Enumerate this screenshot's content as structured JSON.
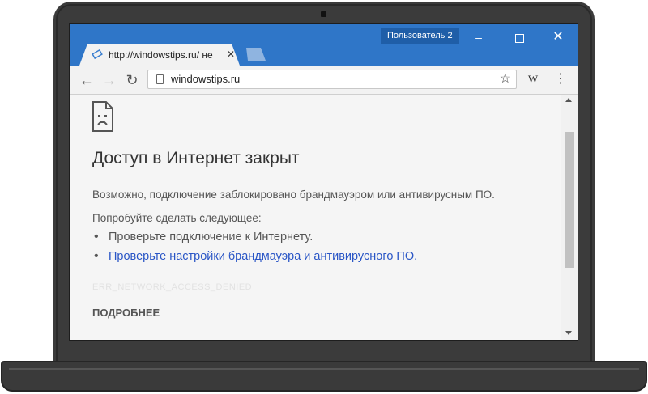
{
  "window": {
    "profile_label": "Пользователь 2",
    "minimize_glyph": "–",
    "close_glyph": "✕"
  },
  "tab": {
    "title": "http://windowstips.ru/ не",
    "favicon": "web-icon",
    "close_glyph": "✕"
  },
  "toolbar": {
    "back_glyph": "←",
    "forward_glyph": "→",
    "reload_glyph": "↻",
    "url": "windowstips.ru",
    "bookmark_glyph": "☆",
    "extension_label": "W",
    "menu_glyph": "⋮"
  },
  "page": {
    "heading": "Доступ в Интернет закрыт",
    "description": "Возможно, подключение заблокировано брандмауэром или антивирусным ПО.",
    "try_label": "Попробуйте сделать следующее:",
    "suggestions": [
      "Проверьте подключение к Интернету.",
      "Проверьте настройки брандмауэра и антивирусного ПО."
    ],
    "error_code": "ERR_NETWORK_ACCESS_DENIED",
    "details_button": "ПОДРОБНЕЕ"
  },
  "colors": {
    "titlebar": "#2f76c8",
    "link": "#2a56c6",
    "laptop": "#3b3b3b"
  }
}
